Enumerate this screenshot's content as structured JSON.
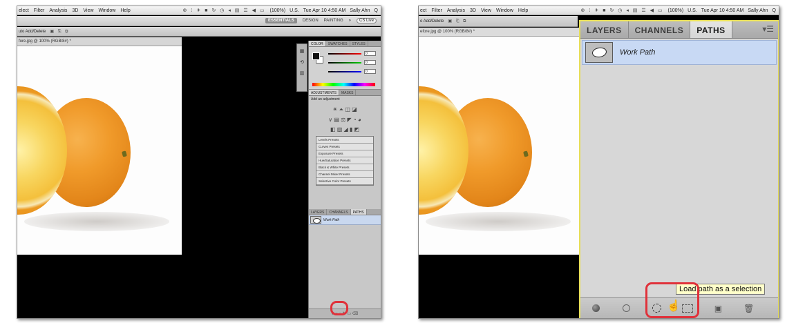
{
  "left": {
    "menubar": {
      "items": [
        "elect",
        "Filter",
        "Analysis",
        "3D",
        "View",
        "Window",
        "Help"
      ],
      "tray_icons": "⊕ ⁝ ✈ ■ ↻ ◷ ◂ ▤ ☰ ◀ ▭",
      "battery": "(100%)",
      "flag": "U.S.",
      "datetime": "Tue Apr 10 4:50 AM",
      "user": "Sally Ahn",
      "search_icon": "Q"
    },
    "workspace": {
      "active": "ESSENTIALS",
      "items": [
        "DESIGN",
        "PAINTING"
      ],
      "more": "»",
      "live": "CS Live"
    },
    "options": {
      "label": "uto Add/Delete",
      "icons": "▣ ⎘ ⧉"
    },
    "doc_tab": "fore.jpg @ 100% (RGB/8#) *",
    "color_panel": {
      "tabs": [
        "COLOR",
        "SWATCHES",
        "STYLES"
      ],
      "values": [
        "0",
        "0",
        "0"
      ],
      "slider_labels": [
        "R",
        "G",
        "B"
      ]
    },
    "adjustments": {
      "tabs": [
        "ADJUSTMENTS",
        "MASKS"
      ],
      "title": "Add an adjustment",
      "row1": "☀ ⏶ ◫ ◪",
      "row2": "∨ ▤ ⚖ ◤ ◔ ◕",
      "row3": "◧ ▨ ◢ ▮ ◩",
      "presets": [
        "Levels Presets",
        "Curves Presets",
        "Exposure Presets",
        "Hue/Saturation Presets",
        "Black & White Presets",
        "Channel Mixer Presets",
        "Selective Color Presets"
      ]
    },
    "paths_mini": {
      "tabs": [
        "LAYERS",
        "CHANNELS",
        "PATHS"
      ],
      "work_path": "Work Path",
      "footer": "● ○ ◌ ✎ ▭ ⌫"
    }
  },
  "right": {
    "menubar": {
      "items": [
        "ect",
        "Filter",
        "Analysis",
        "3D",
        "View",
        "Window",
        "Help"
      ],
      "tray_icons": "⊕ ⁝ ✈ ■ ↻ ◷ ◂ ▤ ☰ ◀ ▭",
      "battery": "(100%)",
      "flag": "U.S.",
      "datetime": "Tue Apr 10 4:50 AM",
      "user": "Sally Ahn",
      "search_icon": "Q"
    },
    "options": {
      "label": "o Add/Delete",
      "icons": "▣ ⎘ ⧉"
    },
    "doc_tab": "efore.jpg @ 100% (RGB/8#) *",
    "paths_panel": {
      "tabs": [
        "LAYERS",
        "CHANNELS",
        "PATHS"
      ],
      "active_tab": "PATHS",
      "menu_icon": "▾☰",
      "paths": [
        {
          "name": "Work Path"
        }
      ],
      "footer_icons": [
        "fill-path-icon",
        "stroke-path-icon",
        "load-selection-icon",
        "make-work-path-icon",
        "new-path-icon",
        "delete-path-icon"
      ]
    },
    "tooltip": "Load path as a selection"
  },
  "colors": {
    "callout": "#e0313a",
    "panel_highlight": "#e7de57",
    "selected_row": "#c8d9f4",
    "tooltip_bg": "#ffffc9"
  }
}
